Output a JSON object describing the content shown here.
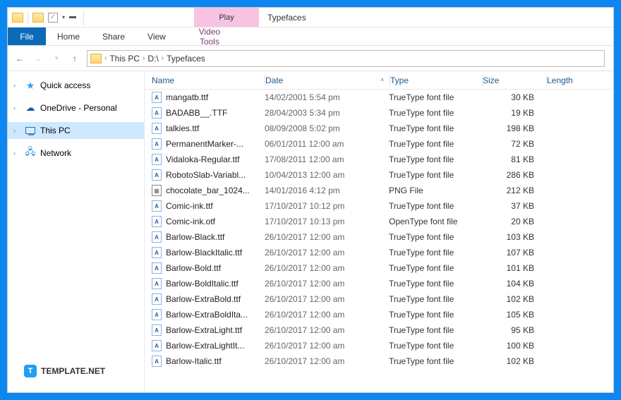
{
  "titlebar": {
    "contextual_group": "Play",
    "contextual_tab": "Video Tools",
    "title": "Typefaces"
  },
  "ribbon": {
    "file": "File",
    "home": "Home",
    "share": "Share",
    "view": "View"
  },
  "breadcrumb": {
    "root": "This PC",
    "drive": "D:\\",
    "folder": "Typefaces"
  },
  "sidebar": {
    "quick_access": "Quick access",
    "onedrive": "OneDrive - Personal",
    "this_pc": "This PC",
    "network": "Network"
  },
  "columns": {
    "name": "Name",
    "date": "Date",
    "type": "Type",
    "size": "Size",
    "length": "Length"
  },
  "files": [
    {
      "name": "mangatb.ttf",
      "date": "14/02/2001 5:54 pm",
      "type": "TrueType font file",
      "size": "30 KB",
      "icon": "ttf"
    },
    {
      "name": "BADABB__.TTF",
      "date": "28/04/2003 5:34 pm",
      "type": "TrueType font file",
      "size": "19 KB",
      "icon": "ttf"
    },
    {
      "name": "talkies.ttf",
      "date": "08/09/2008 5:02 pm",
      "type": "TrueType font file",
      "size": "198 KB",
      "icon": "ttf"
    },
    {
      "name": "PermanentMarker-...",
      "date": "06/01/2011 12:00 am",
      "type": "TrueType font file",
      "size": "72 KB",
      "icon": "ttf"
    },
    {
      "name": "Vidaloka-Regular.ttf",
      "date": "17/08/2011 12:00 am",
      "type": "TrueType font file",
      "size": "81 KB",
      "icon": "ttf"
    },
    {
      "name": "RobotoSlab-Variabl...",
      "date": "10/04/2013 12:00 am",
      "type": "TrueType font file",
      "size": "286 KB",
      "icon": "ttf"
    },
    {
      "name": "chocolate_bar_1024...",
      "date": "14/01/2016 4:12 pm",
      "type": "PNG File",
      "size": "212 KB",
      "icon": "png"
    },
    {
      "name": "Comic-ink.ttf",
      "date": "17/10/2017 10:12 pm",
      "type": "TrueType font file",
      "size": "37 KB",
      "icon": "ttf"
    },
    {
      "name": "Comic-ink.otf",
      "date": "17/10/2017 10:13 pm",
      "type": "OpenType font file",
      "size": "20 KB",
      "icon": "ttf"
    },
    {
      "name": "Barlow-Black.ttf",
      "date": "26/10/2017 12:00 am",
      "type": "TrueType font file",
      "size": "103 KB",
      "icon": "ttf"
    },
    {
      "name": "Barlow-BlackItalic.ttf",
      "date": "26/10/2017 12:00 am",
      "type": "TrueType font file",
      "size": "107 KB",
      "icon": "ttf"
    },
    {
      "name": "Barlow-Bold.ttf",
      "date": "26/10/2017 12:00 am",
      "type": "TrueType font file",
      "size": "101 KB",
      "icon": "ttf"
    },
    {
      "name": "Barlow-BoldItalic.ttf",
      "date": "26/10/2017 12:00 am",
      "type": "TrueType font file",
      "size": "104 KB",
      "icon": "ttf"
    },
    {
      "name": "Barlow-ExtraBold.ttf",
      "date": "26/10/2017 12:00 am",
      "type": "TrueType font file",
      "size": "102 KB",
      "icon": "ttf"
    },
    {
      "name": "Barlow-ExtraBoldIta...",
      "date": "26/10/2017 12:00 am",
      "type": "TrueType font file",
      "size": "105 KB",
      "icon": "ttf"
    },
    {
      "name": "Barlow-ExtraLight.ttf",
      "date": "26/10/2017 12:00 am",
      "type": "TrueType font file",
      "size": "95 KB",
      "icon": "ttf"
    },
    {
      "name": "Barlow-ExtraLightIt...",
      "date": "26/10/2017 12:00 am",
      "type": "TrueType font file",
      "size": "100 KB",
      "icon": "ttf"
    },
    {
      "name": "Barlow-Italic.ttf",
      "date": "26/10/2017 12:00 am",
      "type": "TrueType font file",
      "size": "102 KB",
      "icon": "ttf"
    }
  ],
  "watermark": "TEMPLATE.NET"
}
